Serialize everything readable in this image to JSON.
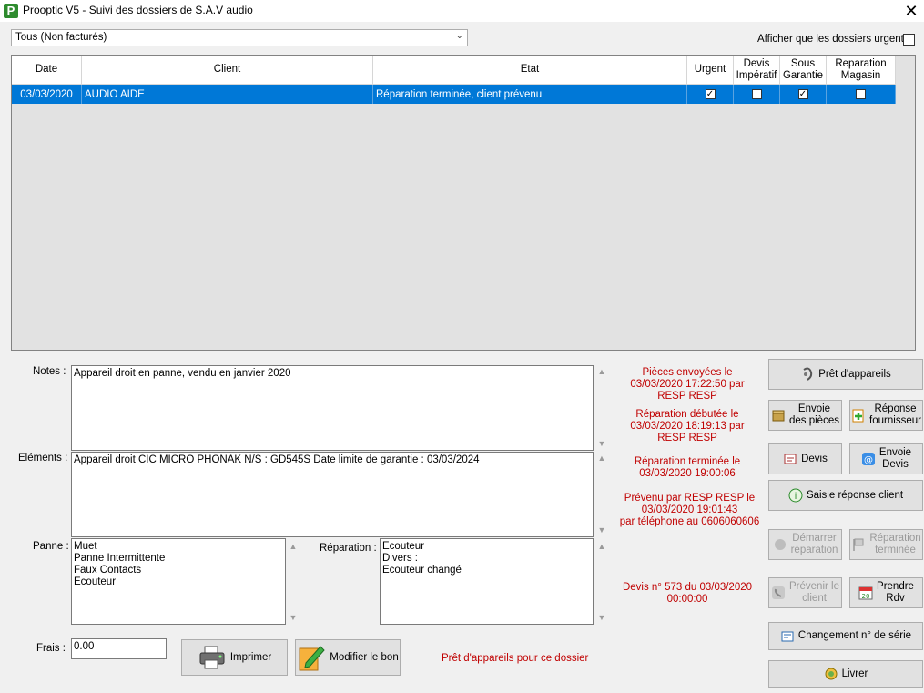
{
  "window": {
    "title": "Prooptic V5 - Suivi des dossiers de S.A.V audio",
    "app_icon_letter": "P"
  },
  "filter": {
    "value": "Tous (Non facturés)"
  },
  "urgent_only": {
    "label": "Afficher que les dossiers urgents",
    "checked": false
  },
  "grid": {
    "headers": {
      "date": "Date",
      "client": "Client",
      "etat": "Etat",
      "urgent": "Urgent",
      "devis_l1": "Devis",
      "devis_l2": "Impératif",
      "garantie_l1": "Sous",
      "garantie_l2": "Garantie",
      "magasin_l1": "Reparation",
      "magasin_l2": "Magasin"
    },
    "rows": [
      {
        "date": "03/03/2020",
        "client": "AUDIO AIDE",
        "etat": "Réparation terminée, client prévenu",
        "urgent": true,
        "devis_imperatif": false,
        "sous_garantie": true,
        "reparation_magasin": false
      }
    ]
  },
  "notes": {
    "label": "Notes :",
    "value": "Appareil droit en panne, vendu en janvier 2020"
  },
  "elements": {
    "label": "Eléments :",
    "value": "Appareil droit CIC MICRO PHONAK N/S : GD545S  Date limite de garantie : 03/03/2024"
  },
  "panne": {
    "label": "Panne :",
    "value": "Muet\nPanne Intermittente\nFaux Contacts\nEcouteur"
  },
  "reparation": {
    "label": "Réparation :",
    "value": "Ecouteur\nDivers :\nEcouteur changé"
  },
  "frais": {
    "label": "Frais :",
    "value": "0.00"
  },
  "status": {
    "pieces": "Pièces envoyées le\n03/03/2020 17:22:50 par\nRESP RESP",
    "debut": "Réparation débutée le\n03/03/2020 18:19:13 par\nRESP RESP",
    "terminee": "Réparation terminée le\n03/03/2020 19:00:06",
    "prevenu": "Prévenu par RESP RESP le\n03/03/2020 19:01:43\npar téléphone au 0606060606",
    "devis": "Devis n° 573 du 03/03/2020\n00:00:00",
    "pret": "Prêt d'appareils pour ce dossier"
  },
  "buttons": {
    "imprimer": "Imprimer",
    "modifier": "Modifier le bon",
    "pret_appareils": "Prêt d'appareils",
    "envoie_pieces": "Envoie\ndes pièces",
    "reponse_fournisseur": "Réponse\nfournisseur",
    "devis": "Devis",
    "envoie_devis": "Envoie\nDevis",
    "saisie_reponse": "Saisie réponse client",
    "demarrer_reparation": "Démarrer\nréparation",
    "reparation_terminee": "Réparation\nterminée",
    "prevenir_client": "Prévenir le\nclient",
    "prendre_rdv": "Prendre\nRdv",
    "changement_serie": "Changement n° de série",
    "livrer": "Livrer"
  },
  "colors": {
    "selection": "#0078d7",
    "status_text": "#c00000"
  }
}
